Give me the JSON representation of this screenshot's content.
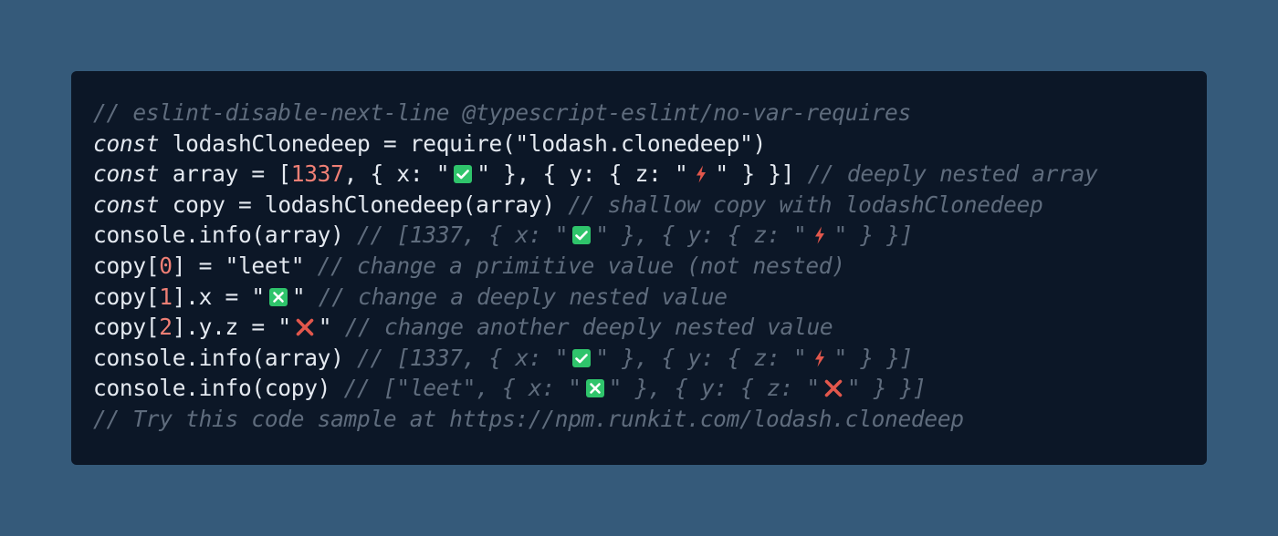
{
  "code": {
    "lines": [
      [
        {
          "t": "cm",
          "v": "// eslint-disable-next-line @typescript-eslint/no-var-requires"
        }
      ],
      [
        {
          "t": "kw",
          "v": "const"
        },
        {
          "t": "plain",
          "v": " lodashClonedeep = require(\"lodash.clonedeep\")"
        }
      ],
      [
        {
          "t": "kw",
          "v": "const"
        },
        {
          "t": "plain",
          "v": " array = ["
        },
        {
          "t": "num",
          "v": "1337"
        },
        {
          "t": "plain",
          "v": ", { x: \""
        },
        {
          "t": "icon",
          "v": "check-mark-button-icon"
        },
        {
          "t": "plain",
          "v": "\" }, { y: { z: \""
        },
        {
          "t": "icon",
          "v": "lightning-bolt-icon"
        },
        {
          "t": "plain",
          "v": "\" } }] "
        },
        {
          "t": "cm",
          "v": "// deeply nested array"
        }
      ],
      [
        {
          "t": "kw",
          "v": "const"
        },
        {
          "t": "plain",
          "v": " copy = lodashClonedeep(array) "
        },
        {
          "t": "cm",
          "v": "// shallow copy with lodashClonedeep"
        }
      ],
      [
        {
          "t": "plain",
          "v": "console.info(array) "
        },
        {
          "t": "cm",
          "v": "// [1337, { x: \""
        },
        {
          "t": "icon",
          "v": "check-mark-button-icon"
        },
        {
          "t": "cm",
          "v": "\" }, { y: { z: \""
        },
        {
          "t": "icon",
          "v": "lightning-bolt-icon"
        },
        {
          "t": "cm",
          "v": "\" } }]"
        }
      ],
      [
        {
          "t": "plain",
          "v": "copy["
        },
        {
          "t": "num",
          "v": "0"
        },
        {
          "t": "plain",
          "v": "] = \"leet\" "
        },
        {
          "t": "cm",
          "v": "// change a primitive value (not nested)"
        }
      ],
      [
        {
          "t": "plain",
          "v": "copy["
        },
        {
          "t": "num",
          "v": "1"
        },
        {
          "t": "plain",
          "v": "].x = \""
        },
        {
          "t": "icon",
          "v": "cross-mark-button-icon"
        },
        {
          "t": "plain",
          "v": "\" "
        },
        {
          "t": "cm",
          "v": "// change a deeply nested value"
        }
      ],
      [
        {
          "t": "plain",
          "v": "copy["
        },
        {
          "t": "num",
          "v": "2"
        },
        {
          "t": "plain",
          "v": "].y.z = \""
        },
        {
          "t": "icon",
          "v": "cross-mark-icon"
        },
        {
          "t": "plain",
          "v": "\" "
        },
        {
          "t": "cm",
          "v": "// change another deeply nested value"
        }
      ],
      [
        {
          "t": "plain",
          "v": "console.info(array) "
        },
        {
          "t": "cm",
          "v": "// [1337, { x: \""
        },
        {
          "t": "icon",
          "v": "check-mark-button-icon"
        },
        {
          "t": "cm",
          "v": "\" }, { y: { z: \""
        },
        {
          "t": "icon",
          "v": "lightning-bolt-icon"
        },
        {
          "t": "cm",
          "v": "\" } }]"
        }
      ],
      [
        {
          "t": "plain",
          "v": "console.info(copy) "
        },
        {
          "t": "cm",
          "v": "// [\"leet\", { x: \""
        },
        {
          "t": "icon",
          "v": "cross-mark-button-icon"
        },
        {
          "t": "cm",
          "v": "\" }, { y: { z: \""
        },
        {
          "t": "icon",
          "v": "cross-mark-icon"
        },
        {
          "t": "cm",
          "v": "\" } }]"
        }
      ],
      [
        {
          "t": "cm",
          "v": "// Try this code sample at https://npm.runkit.com/lodash.clonedeep"
        }
      ]
    ]
  },
  "colors": {
    "page_background": "#355a7a",
    "editor_background": "#0c1727",
    "text": "#e4e9f0",
    "comment": "#5f6c7d",
    "number": "#ef7f75",
    "emoji_green": "#2fc46b",
    "emoji_red": "#e2574c"
  }
}
